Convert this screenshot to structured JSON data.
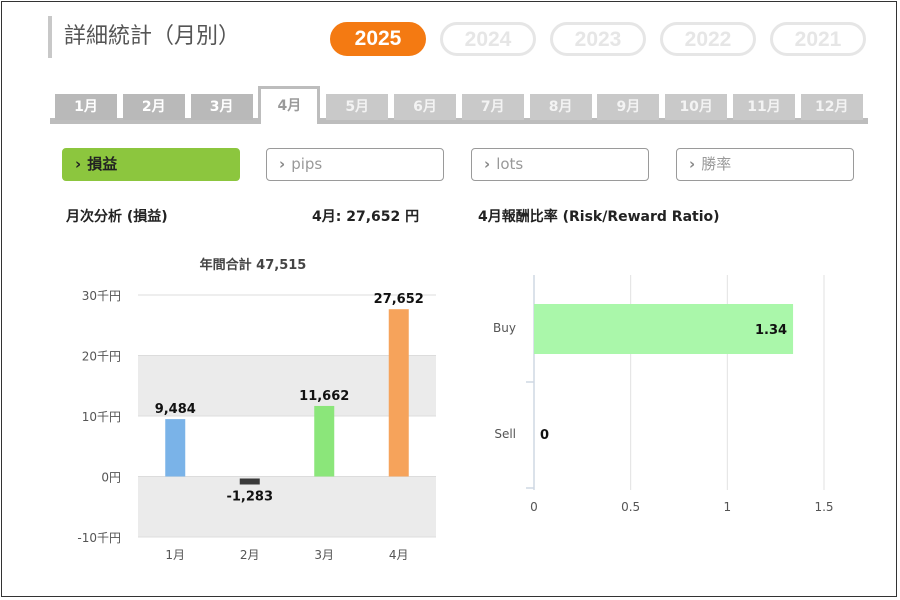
{
  "page": {
    "title": "詳細統計（月別）"
  },
  "years": [
    {
      "label": "2025",
      "active": true
    },
    {
      "label": "2024",
      "active": false
    },
    {
      "label": "2023",
      "active": false
    },
    {
      "label": "2022",
      "active": false
    },
    {
      "label": "2021",
      "active": false
    }
  ],
  "months": [
    {
      "label": "1月",
      "state": "done"
    },
    {
      "label": "2月",
      "state": "done"
    },
    {
      "label": "3月",
      "state": "done"
    },
    {
      "label": "4月",
      "state": "active"
    },
    {
      "label": "5月",
      "state": "future"
    },
    {
      "label": "6月",
      "state": "future"
    },
    {
      "label": "7月",
      "state": "future"
    },
    {
      "label": "8月",
      "state": "future"
    },
    {
      "label": "9月",
      "state": "future"
    },
    {
      "label": "10月",
      "state": "future"
    },
    {
      "label": "11月",
      "state": "future"
    },
    {
      "label": "12月",
      "state": "future"
    }
  ],
  "metrics": [
    {
      "label": "損益",
      "active": true
    },
    {
      "label": "pips",
      "active": false
    },
    {
      "label": "lots",
      "active": false
    },
    {
      "label": "勝率",
      "active": false
    }
  ],
  "chevron": "›",
  "left_panel": {
    "title": "月次分析 (損益)",
    "month_summary": "4月:  27,652 円"
  },
  "right_panel": {
    "title": "4月報酬比率 (Risk/Reward Ratio)"
  },
  "chart_data": [
    {
      "type": "bar",
      "title": "年間合計 47,515",
      "categories": [
        "1月",
        "2月",
        "3月",
        "4月"
      ],
      "values": [
        9484,
        -1283,
        11662,
        27652
      ],
      "value_labels": [
        "9,484",
        "-1,283",
        "11,662",
        "27,652"
      ],
      "colors": [
        "#7ab3e8",
        "#3a3a3a",
        "#8be67a",
        "#f6a35b"
      ],
      "ylim": [
        -10000,
        30000
      ],
      "y_ticks": [
        -10000,
        0,
        10000,
        20000,
        30000
      ],
      "y_tick_labels": [
        "-10千円",
        "0円",
        "10千円",
        "20千円",
        "30千円"
      ],
      "grid": true
    },
    {
      "type": "bar",
      "orientation": "horizontal",
      "categories": [
        "Buy",
        "Sell"
      ],
      "values": [
        1.34,
        0
      ],
      "value_labels": [
        "1.34",
        "0"
      ],
      "colors": [
        "#aaf7aa",
        "#aaf7aa"
      ],
      "xlim": [
        0,
        1.5
      ],
      "x_ticks": [
        0,
        0.5,
        1,
        1.5
      ],
      "x_tick_labels": [
        "0",
        "0.5",
        "1",
        "1.5"
      ],
      "grid": true
    }
  ]
}
